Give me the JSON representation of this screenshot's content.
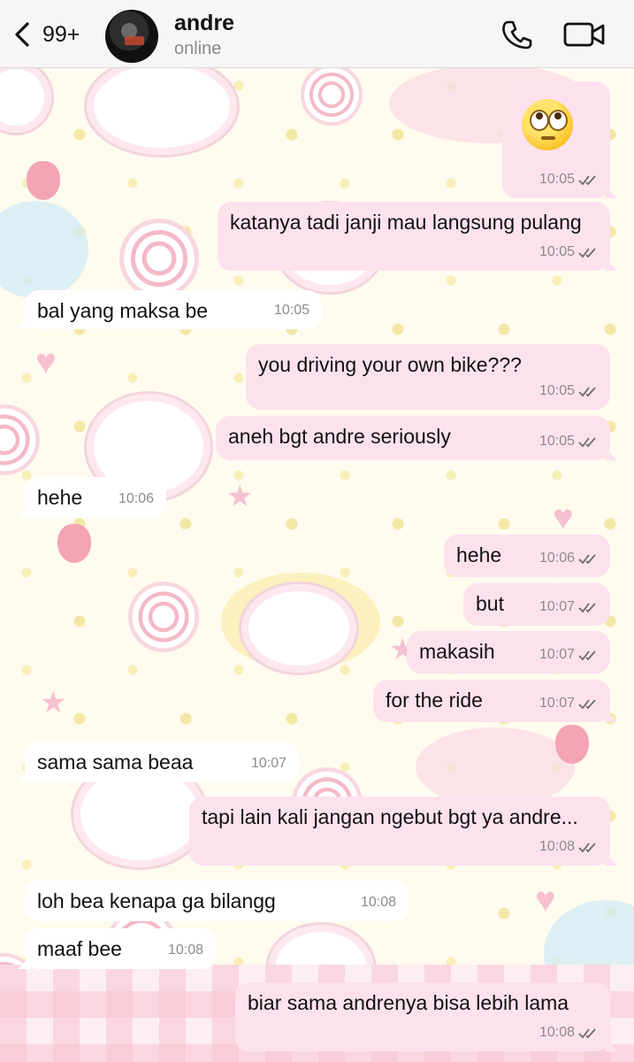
{
  "header": {
    "back_count": "99+",
    "contact_name": "andre",
    "contact_status": "online"
  },
  "messages": [
    {
      "dir": "out",
      "text": "🙄",
      "time": "10:05",
      "read": true,
      "emoji_only": true
    },
    {
      "dir": "out",
      "text": "katanya tadi janji mau langsung pulang",
      "time": "10:05",
      "read": true
    },
    {
      "dir": "in",
      "text": "bal yang maksa be",
      "time": "10:05"
    },
    {
      "dir": "out",
      "text": "you driving your own bike???",
      "time": "10:05",
      "read": true
    },
    {
      "dir": "out",
      "text": "aneh bgt andre seriously",
      "time": "10:05",
      "read": true
    },
    {
      "dir": "in",
      "text": "hehe",
      "time": "10:06"
    },
    {
      "dir": "out",
      "text": "hehe",
      "time": "10:06",
      "read": true
    },
    {
      "dir": "out",
      "text": "but",
      "time": "10:07",
      "read": true
    },
    {
      "dir": "out",
      "text": "makasih",
      "time": "10:07",
      "read": true
    },
    {
      "dir": "out",
      "text": "for the ride",
      "time": "10:07",
      "read": true
    },
    {
      "dir": "in",
      "text": "sama sama beaa",
      "time": "10:07"
    },
    {
      "dir": "out",
      "text": "tapi lain kali jangan ngebut bgt ya andre...",
      "time": "10:08",
      "read": true
    },
    {
      "dir": "in",
      "text": "loh bea kenapa ga bilangg",
      "time": "10:08"
    },
    {
      "dir": "in",
      "text": "maaf bee",
      "time": "10:08"
    },
    {
      "dir": "out",
      "text": "biar sama andrenya bisa lebih lama",
      "time": "10:08",
      "read": true
    }
  ],
  "colors": {
    "outgoing_bubble": "#fde2ee",
    "incoming_bubble": "#ffffff",
    "read_ticks": "#6b6b6b",
    "header_bg": "#f6f6f6"
  },
  "icons": {
    "back": "chevron-left-icon",
    "call": "phone-icon",
    "video": "video-camera-icon",
    "read": "double-check-icon"
  }
}
